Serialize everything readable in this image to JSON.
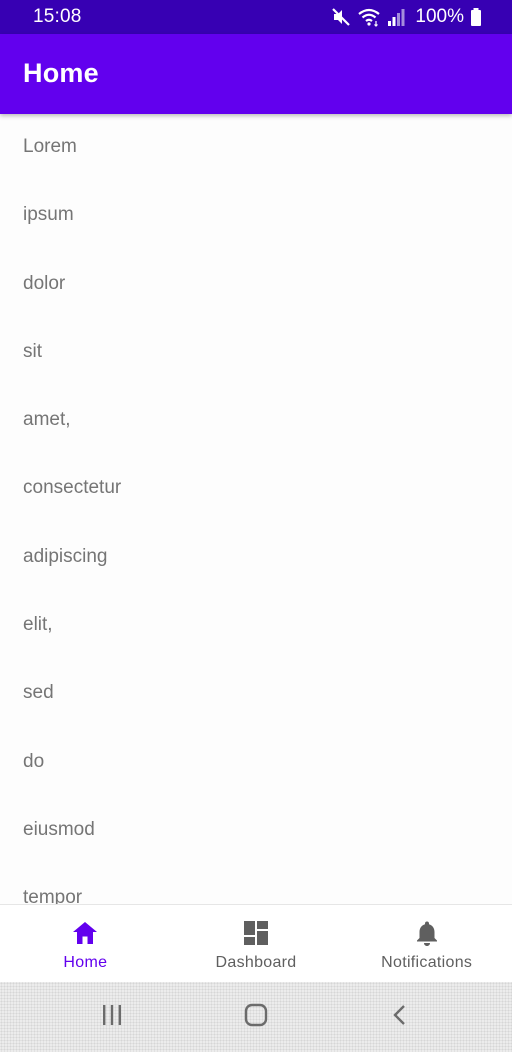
{
  "status_bar": {
    "time": "15:08",
    "battery": "100%",
    "icons": [
      "mute-icon",
      "wifi-icon",
      "signal-icon",
      "battery-icon"
    ]
  },
  "app_bar": {
    "title": "Home",
    "color": "#6200ee"
  },
  "status_bar_color": "#3700b3",
  "list": {
    "items": [
      "Lorem",
      "ipsum",
      "dolor",
      "sit",
      "amet,",
      "consectetur",
      "adipiscing",
      "elit,",
      "sed",
      "do",
      "eiusmod",
      "tempor"
    ]
  },
  "bottom_nav": {
    "items": [
      {
        "label": "Home",
        "icon": "home-icon",
        "active": true
      },
      {
        "label": "Dashboard",
        "icon": "dashboard-icon",
        "active": false
      },
      {
        "label": "Notifications",
        "icon": "bell-icon",
        "active": false
      }
    ],
    "active_color": "#6200ee",
    "inactive_color": "#5f5f5f"
  },
  "system_nav": {
    "buttons": [
      "recent-apps-icon",
      "home-button-icon",
      "back-icon"
    ]
  }
}
